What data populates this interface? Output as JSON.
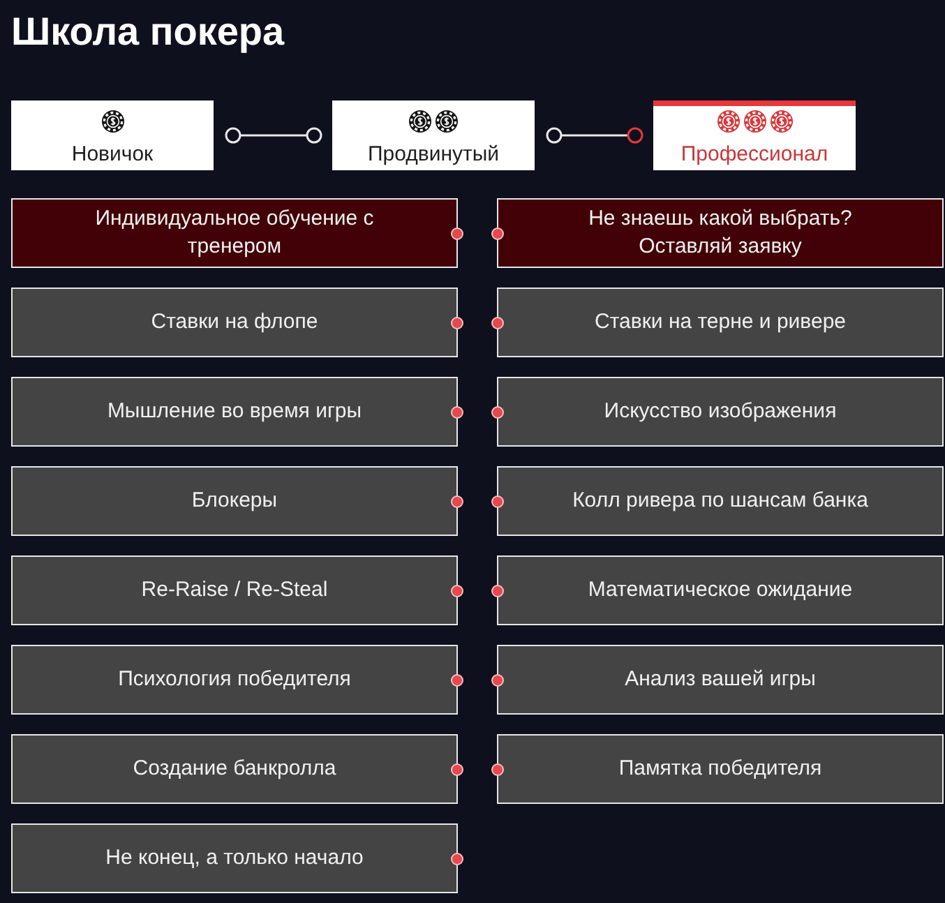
{
  "title": "Школа покера",
  "levels": [
    {
      "label": "Новичок",
      "selected": false,
      "chips": [
        {
          "kind": "chip"
        }
      ]
    },
    {
      "label": "Продвинутый",
      "selected": false,
      "chips": [
        {
          "kind": "chip"
        },
        {
          "kind": "chip"
        }
      ]
    },
    {
      "label": "Профессионал",
      "selected": true,
      "chips": [
        {
          "kind": "chip"
        },
        {
          "kind": "chip"
        },
        {
          "kind": "chip"
        }
      ]
    }
  ],
  "columns": [
    {
      "courses": [
        {
          "label": "Индивидуальное обучение с тренером",
          "kind": "featured"
        },
        {
          "label": "Ставки на флопе",
          "kind": "regular"
        },
        {
          "label": "Мышление во время игры",
          "kind": "regular"
        },
        {
          "label": "Блокеры",
          "kind": "regular"
        },
        {
          "label": "Re-Raise / Re-Steal",
          "kind": "regular"
        },
        {
          "label": "Психология победителя",
          "kind": "regular"
        },
        {
          "label": "Создание банкролла",
          "kind": "regular"
        },
        {
          "label": "Не конец, а только начало",
          "kind": "regular"
        }
      ]
    },
    {
      "courses": [
        {
          "label": "Не знаешь какой выбрать? Оставляй заявку",
          "kind": "featured"
        },
        {
          "label": "Ставки на терне и ривере",
          "kind": "regular"
        },
        {
          "label": "Искусство изображения",
          "kind": "regular"
        },
        {
          "label": "Колл ривера по шансам банка",
          "kind": "regular"
        },
        {
          "label": "Математическое ожидание",
          "kind": "regular"
        },
        {
          "label": "Анализ вашей игры",
          "kind": "regular"
        },
        {
          "label": "Памятка победителя",
          "kind": "regular"
        }
      ]
    }
  ]
}
